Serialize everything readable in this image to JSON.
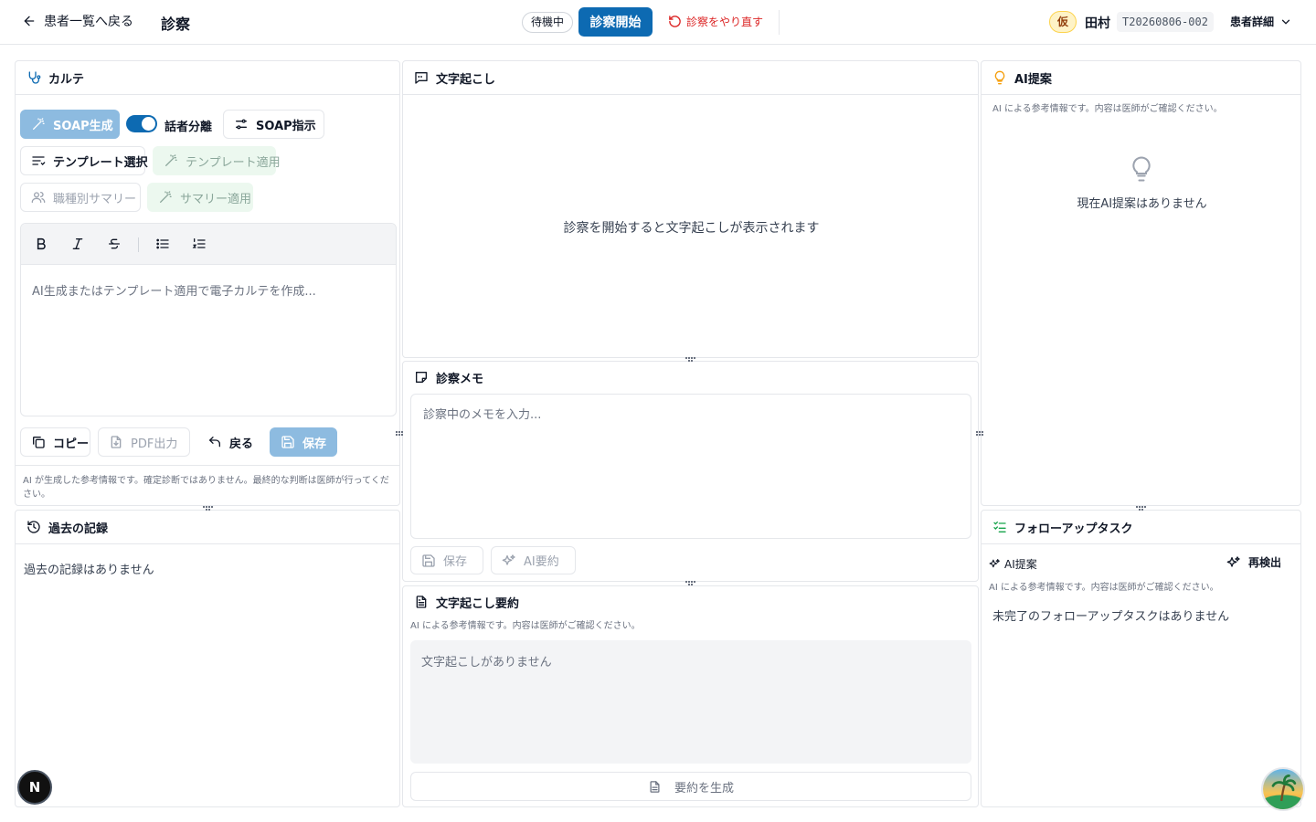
{
  "header": {
    "back_label": "患者一覧へ戻る",
    "title": "診察",
    "status": "待機中",
    "start_label": "診察開始",
    "redo_label": "診察をやり直す",
    "temp_badge": "仮",
    "patient_name": "田村",
    "patient_id": "T20260806-002",
    "detail_label": "患者詳細"
  },
  "karte": {
    "title": "カルテ",
    "soap_gen": "SOAP生成",
    "speaker_sep": "話者分離",
    "soap_instr": "SOAP指示",
    "template_select": "テンプレート選択",
    "template_apply": "テンプレート適用",
    "role_summary": "職種別サマリー",
    "summary_apply": "サマリー適用",
    "editor_placeholder": "AI生成またはテンプレート適用で電子カルテを作成...",
    "copy": "コピー",
    "pdf": "PDF出力",
    "undo": "戻る",
    "save": "保存",
    "disclaimer": "AI が生成した参考情報です。確定診断ではありません。最終的な判断は医師が行ってください。"
  },
  "history": {
    "title": "過去の記録",
    "empty": "過去の記録はありません"
  },
  "transcript": {
    "title": "文字起こし",
    "empty": "診察を開始すると文字起こしが表示されます"
  },
  "memo": {
    "title": "診察メモ",
    "placeholder": "診察中のメモを入力...",
    "save": "保存",
    "ai_summary": "AI要約"
  },
  "summary": {
    "title": "文字起こし要約",
    "note": "AI による参考情報です。内容は医師がご確認ください。",
    "empty": "文字起こしがありません",
    "generate": "要約を生成"
  },
  "ai_suggest": {
    "title": "AI提案",
    "note": "AI による参考情報です。内容は医師がご確認ください。",
    "empty": "現在AI提案はありません"
  },
  "followup": {
    "title": "フォローアップタスク",
    "ai_label": "AI提案",
    "redetect": "再検出",
    "note": "AI による参考情報です。内容は医師がご確認ください。",
    "empty": "未完了のフォローアップタスクはありません"
  },
  "fab": {
    "letter": "N"
  },
  "colors": {
    "primary": "#0d6ab2",
    "danger": "#dc2626",
    "border": "#e5e7eb"
  }
}
